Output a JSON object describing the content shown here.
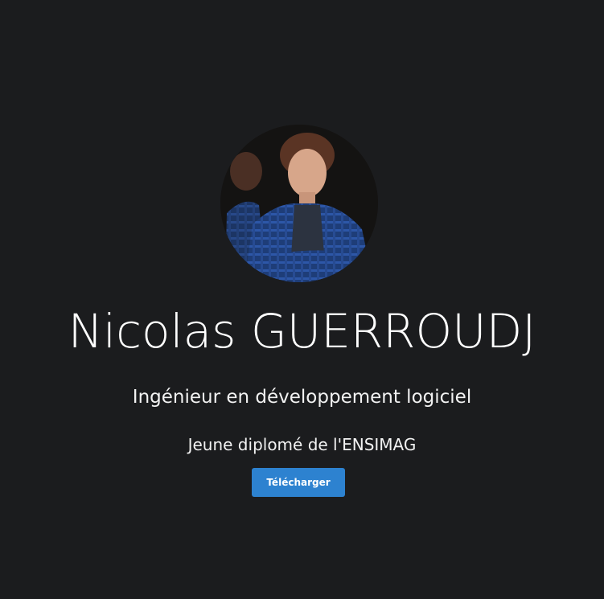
{
  "profile": {
    "name": "Nicolas GUERROUDJ",
    "role": "Ingénieur en développement logiciel",
    "school": "Jeune diplomé de l'ENSIMAG",
    "download_label": "Télécharger",
    "avatar_icon": "profile-photo"
  },
  "colors": {
    "background": "#1b1c1e",
    "accent": "#2d82d0",
    "text": "#ffffff"
  }
}
